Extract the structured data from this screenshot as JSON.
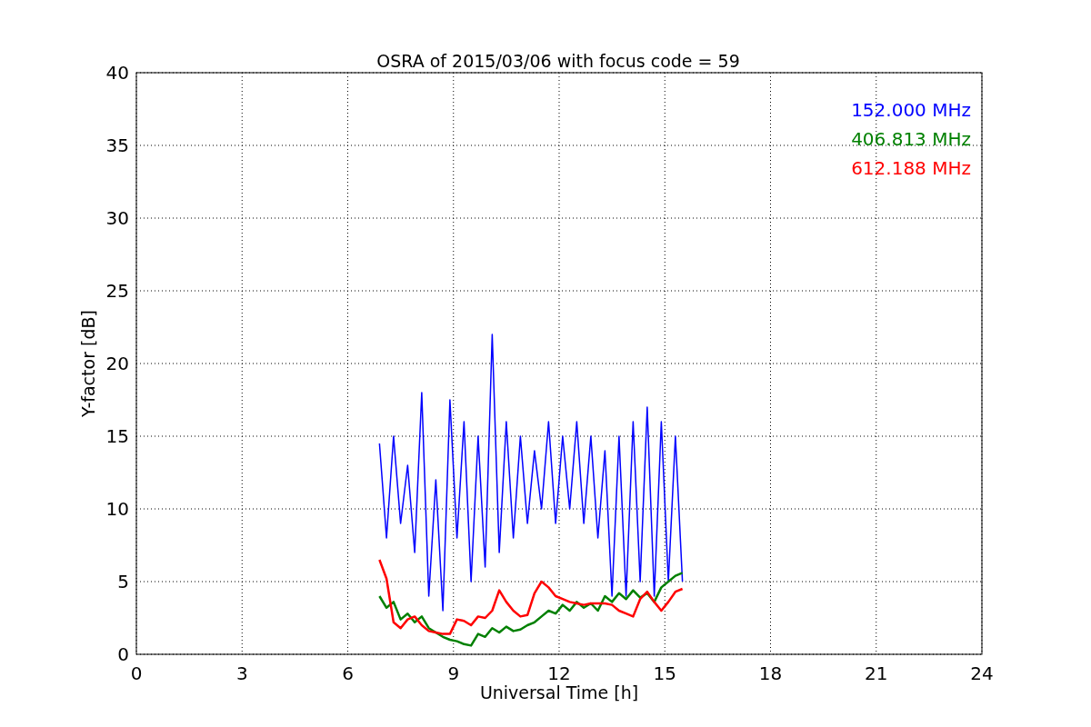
{
  "chart_data": {
    "type": "line",
    "title": "OSRA of 2015/03/06 with focus code = 59",
    "xlabel": "Universal Time [h]",
    "ylabel": "Y-factor [dB]",
    "grid": true,
    "xlim": [
      0,
      24
    ],
    "ylim": [
      0,
      40
    ],
    "xticks": [
      0,
      3,
      6,
      9,
      12,
      15,
      18,
      21,
      24
    ],
    "yticks": [
      0,
      5,
      10,
      15,
      20,
      25,
      30,
      35,
      40
    ],
    "x": [
      6.9,
      7.1,
      7.3,
      7.5,
      7.7,
      7.9,
      8.1,
      8.3,
      8.5,
      8.7,
      8.9,
      9.1,
      9.3,
      9.5,
      9.7,
      9.9,
      10.1,
      10.3,
      10.5,
      10.7,
      10.9,
      11.1,
      11.3,
      11.5,
      11.7,
      11.9,
      12.1,
      12.3,
      12.5,
      12.7,
      12.9,
      13.1,
      13.3,
      13.5,
      13.7,
      13.9,
      14.1,
      14.3,
      14.5,
      14.7,
      14.9,
      15.1,
      15.3,
      15.5
    ],
    "series": [
      {
        "name": "152.000 MHz",
        "color": "#0000ff",
        "values": [
          14.5,
          8,
          15,
          9,
          13,
          7,
          18,
          4,
          12,
          3,
          17.5,
          8,
          16,
          5,
          15,
          6,
          22,
          7,
          16,
          8,
          15,
          9,
          14,
          10,
          16,
          9,
          15,
          10,
          16,
          9,
          15,
          8,
          14,
          4,
          15,
          4,
          16,
          5,
          17,
          4,
          16,
          5,
          15,
          5
        ]
      },
      {
        "name": "406.813 MHz",
        "color": "#008000",
        "values": [
          4,
          3.2,
          3.6,
          2.4,
          2.8,
          2.2,
          2.6,
          1.8,
          1.5,
          1.2,
          1,
          0.9,
          0.7,
          0.6,
          1.4,
          1.2,
          1.8,
          1.5,
          1.9,
          1.6,
          1.7,
          2.0,
          2.2,
          2.6,
          3.0,
          2.8,
          3.4,
          3.0,
          3.6,
          3.2,
          3.5,
          3.0,
          4.0,
          3.6,
          4.2,
          3.8,
          4.4,
          3.9,
          4.2,
          3.6,
          4.6,
          5.0,
          5.4,
          5.6
        ]
      },
      {
        "name": "612.188 MHz",
        "color": "#ff0000",
        "values": [
          6.5,
          5.2,
          2.2,
          1.8,
          2.4,
          2.6,
          2.0,
          1.6,
          1.5,
          1.4,
          1.4,
          2.4,
          2.3,
          2.0,
          2.6,
          2.5,
          3.0,
          4.4,
          3.6,
          3.0,
          2.6,
          2.7,
          4.2,
          5.0,
          4.6,
          4.0,
          3.8,
          3.6,
          3.5,
          3.4,
          3.5,
          3.5,
          3.5,
          3.4,
          3.0,
          2.8,
          2.6,
          3.8,
          4.3,
          3.6,
          3.0,
          3.6,
          4.3,
          4.5
        ]
      }
    ]
  }
}
